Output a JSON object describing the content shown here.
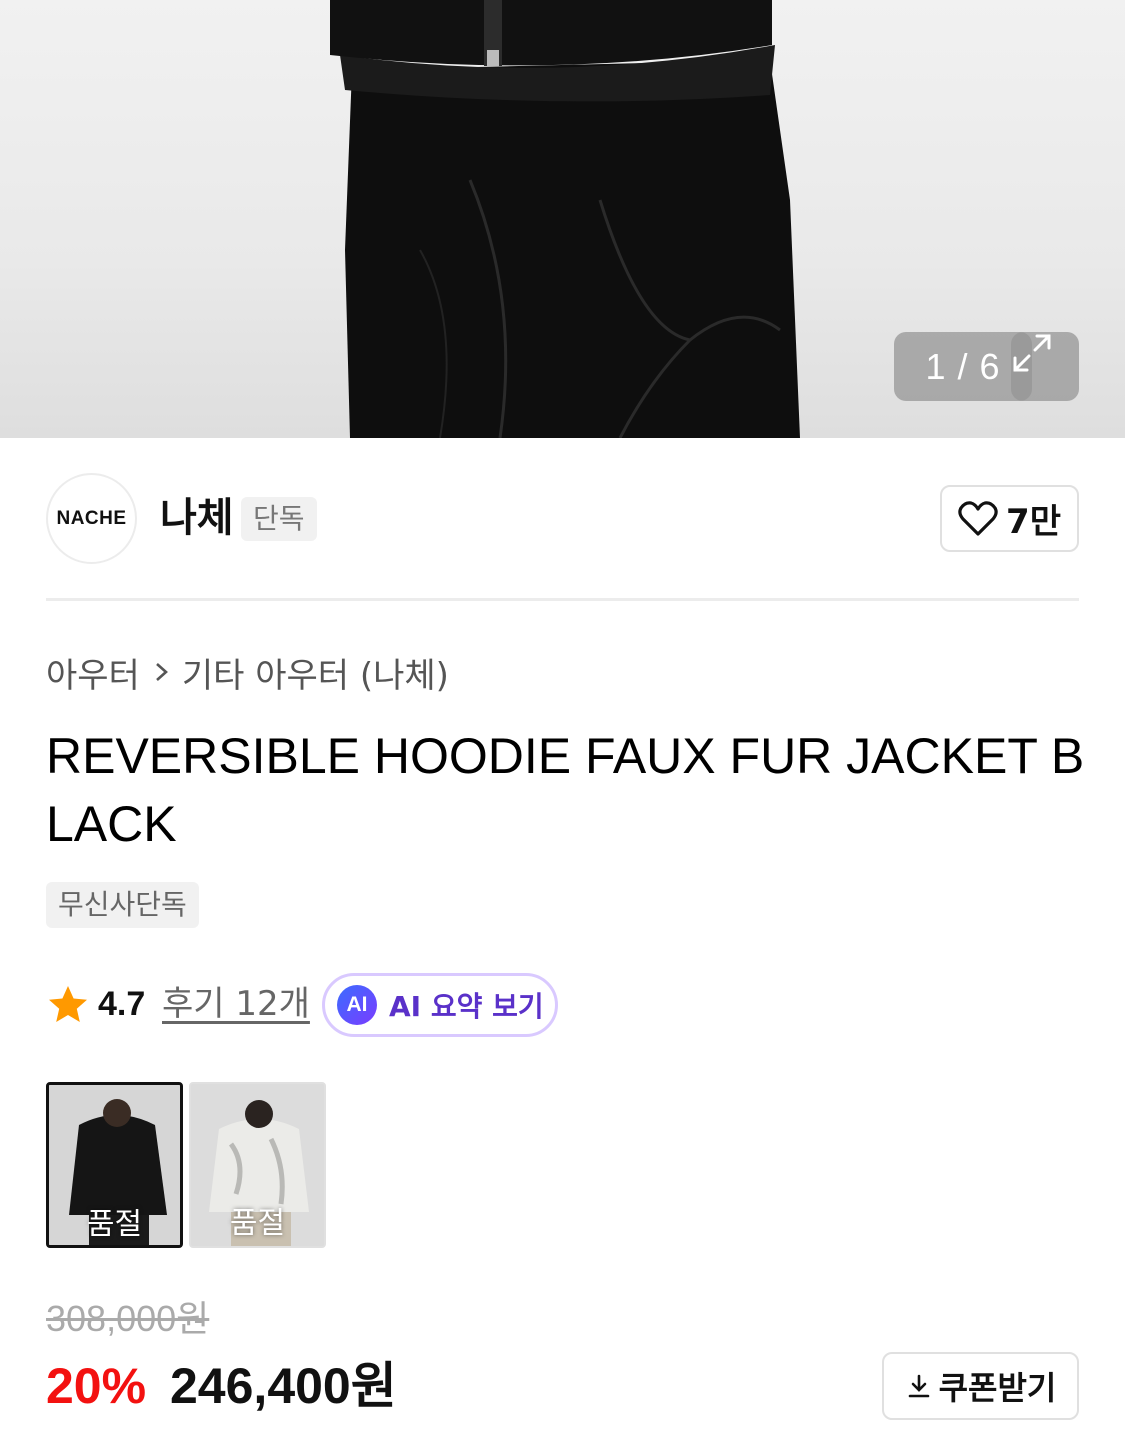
{
  "gallery": {
    "counter": "1 / 6",
    "expand_icon": "expand-icon"
  },
  "brand": {
    "logo_text": "NACHE",
    "name": "나체",
    "badge": "단독",
    "like_count": "7만"
  },
  "breadcrumb": {
    "items": [
      "아우터",
      "기타 아우터 (나체)"
    ]
  },
  "product": {
    "title": "REVERSIBLE HOODIE FAUX FUR JACKET BLACK",
    "tag": "무신사단독",
    "rating": "4.7",
    "reviews_label": "후기 12개",
    "ai_badge": "AI",
    "ai_label": "AI 요약 보기"
  },
  "variants": [
    {
      "status": "품절",
      "color": "black"
    },
    {
      "status": "품절",
      "color": "white"
    }
  ],
  "price": {
    "original": "308,000원",
    "discount": "20%",
    "current": "246,400원",
    "coupon_label": "쿠폰받기"
  },
  "colors": {
    "discount_red": "#f31110",
    "ai_purple": "#5a31c9",
    "star_orange": "#ff9900"
  }
}
